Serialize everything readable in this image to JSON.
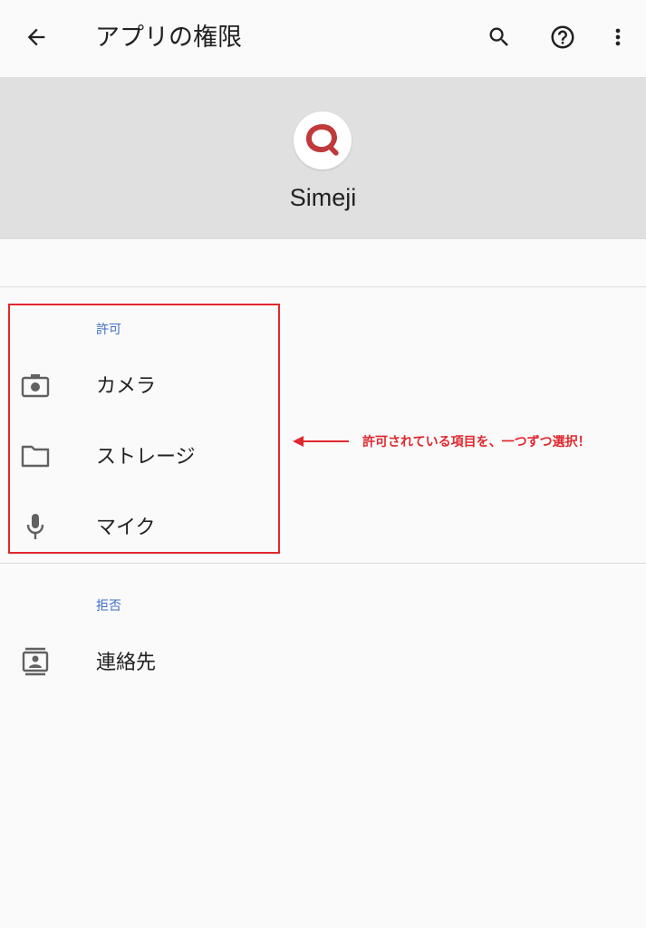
{
  "topbar": {
    "title": "アプリの権限",
    "back_icon": "arrow-back-icon",
    "search_icon": "search-icon",
    "help_icon": "help-icon",
    "more_icon": "more-vert-icon"
  },
  "app": {
    "name": "Simeji",
    "icon": "simeji-app-icon",
    "icon_color": "#c0393b"
  },
  "sections": {
    "allowed": {
      "label": "許可",
      "items": [
        {
          "label": "カメラ",
          "icon": "camera-icon"
        },
        {
          "label": "ストレージ",
          "icon": "folder-icon"
        },
        {
          "label": "マイク",
          "icon": "microphone-icon"
        }
      ]
    },
    "denied": {
      "label": "拒否",
      "items": [
        {
          "label": "連絡先",
          "icon": "contacts-icon"
        }
      ]
    }
  },
  "annotation": {
    "text": "許可されている項目を、一つずつ選択！",
    "color": "#e0282e"
  },
  "colors": {
    "section_label": "#3f6fc4",
    "header_bg": "#e0e0e0",
    "page_bg": "#fafafa"
  }
}
